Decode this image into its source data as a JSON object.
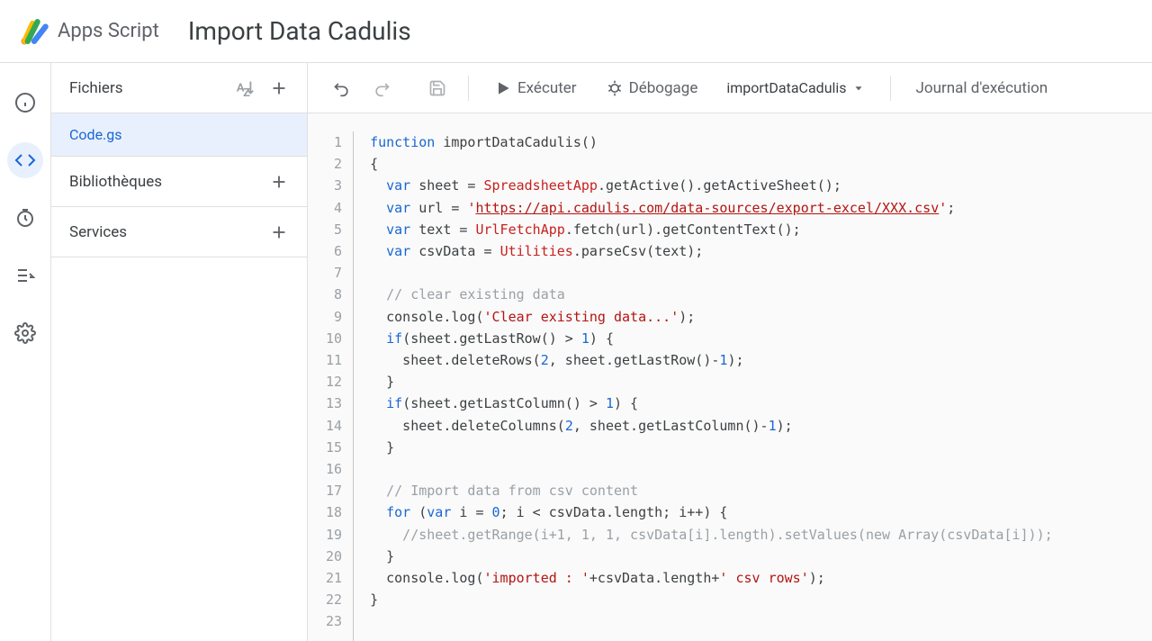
{
  "header": {
    "brand": "Apps Script",
    "project_title": "Import Data Cadulis"
  },
  "sidebar": {
    "files_label": "Fichiers",
    "libraries_label": "Bibliothèques",
    "services_label": "Services",
    "file_name": "Code.gs"
  },
  "toolbar": {
    "run_label": "Exécuter",
    "debug_label": "Débogage",
    "fn_selected": "importDataCadulis",
    "log_label": "Journal d'exécution"
  },
  "code": {
    "lines": [
      1,
      2,
      3,
      4,
      5,
      6,
      7,
      8,
      9,
      10,
      11,
      12,
      13,
      14,
      15,
      16,
      17,
      18,
      19,
      20,
      21,
      22,
      23
    ],
    "tokens": {
      "l1_kw": "function",
      "l1_name": " importDataCadulis()",
      "l2": "{",
      "l3_kw": "var",
      "l3_a": " sheet = ",
      "l3_cls": "SpreadsheetApp",
      "l3_b": ".getActive().getActiveSheet();",
      "l4_kw": "var",
      "l4_a": " url = ",
      "l4_q1": "'",
      "l4_url": "https://api.cadulis.com/data-sources/export-excel/XXX.csv",
      "l4_q2": "'",
      "l4_b": ";",
      "l5_kw": "var",
      "l5_a": " text = ",
      "l5_cls": "UrlFetchApp",
      "l5_b": ".fetch(url).getContentText();",
      "l6_kw": "var",
      "l6_a": " csvData = ",
      "l6_cls": "Utilities",
      "l6_b": ".parseCsv(text);",
      "l8_com": "// clear existing data",
      "l9_a": "console.log(",
      "l9_str": "'Clear existing data...'",
      "l9_b": ");",
      "l10_kw": "if",
      "l10_a": "(sheet.getLastRow() > ",
      "l10_num": "1",
      "l10_b": ") {",
      "l11_a": "  sheet.deleteRows(",
      "l11_n1": "2",
      "l11_b": ", sheet.getLastRow()-",
      "l11_n2": "1",
      "l11_c": ");",
      "l12": "}",
      "l13_kw": "if",
      "l13_a": "(sheet.getLastColumn() > ",
      "l13_num": "1",
      "l13_b": ") {",
      "l14_a": "  sheet.deleteColumns(",
      "l14_n1": "2",
      "l14_b": ", sheet.getLastColumn()-",
      "l14_n2": "1",
      "l14_c": ");",
      "l15": "}",
      "l17_com": "// Import data from csv content",
      "l18_kw1": "for",
      "l18_a": " (",
      "l18_kw2": "var",
      "l18_b": " i = ",
      "l18_n": "0",
      "l18_c": "; i < csvData.length; i++) {",
      "l19_com": "  //sheet.getRange(i+1, 1, 1, csvData[i].length).setValues(new Array(csvData[i]));",
      "l20": "}",
      "l21_a": "console.log(",
      "l21_s1": "'imported : '",
      "l21_b": "+csvData.length+",
      "l21_s2": "' csv rows'",
      "l21_c": ");",
      "l22": "}"
    }
  }
}
